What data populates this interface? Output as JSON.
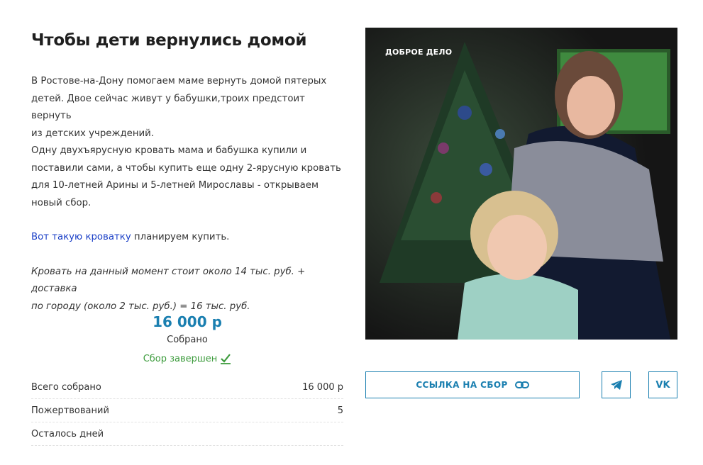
{
  "page": {
    "title": "Чтобы дети вернулись домой",
    "description": {
      "paragraph1": [
        "В Ростове-на-Дону помогаем маме вернуть домой пятерых",
        "детей. Двое сейчас живут у бабушки,троих предстоит вернуть",
        "из детских учреждений.",
        "Одну двухъярусную кровать мама и бабушка купили и",
        "поставили сами, а чтобы купить еще одну 2-ярусную кровать",
        "для 10-летней Арины и 5-летней Мирославы - открываем",
        "новый сбор."
      ],
      "link_text": "Вот такую кроватку",
      "link_suffix": " планируем купить.",
      "italic_lines": [
        "Кровать на данный момент стоит около 14 тыс. руб. + доставка",
        "по городу (около 2 тыс. руб.) = 16 тыс. руб."
      ]
    }
  },
  "fundraising": {
    "amount": "16 000 р",
    "collected_label": "Собрано",
    "status": "Сбор завершен",
    "status_color": "#3c9b3c",
    "accent_color": "#1a7fb0",
    "rows": [
      {
        "label": "Всего собрано",
        "value": "16 000 р"
      },
      {
        "label": "Пожертвований",
        "value": "5"
      },
      {
        "label": "Осталось дней",
        "value": ""
      }
    ]
  },
  "photo": {
    "watermark": "ДОБРОЕ ДЕЛО"
  },
  "actions": {
    "link_button_label": "ССЫЛКА НА СБОР",
    "link_icon": "link-icon",
    "telegram_icon": "telegram-icon",
    "vk_label": "VK"
  }
}
